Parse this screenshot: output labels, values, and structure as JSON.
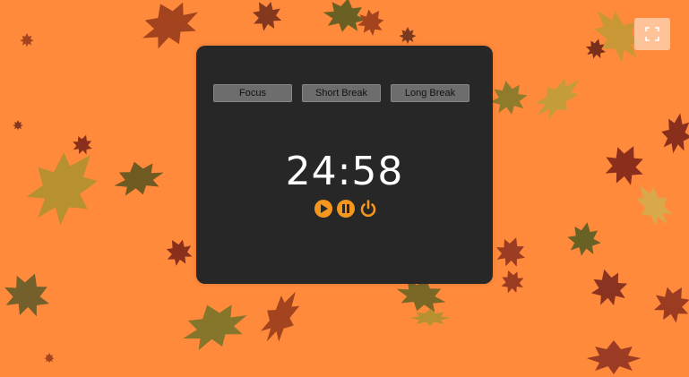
{
  "colors": {
    "background": "#ff8a3c",
    "panel": "#272727",
    "tab": "#6d6d6d",
    "accent": "#f5961e",
    "text": "#ffffff"
  },
  "modes": [
    {
      "label": "Focus"
    },
    {
      "label": "Short Break"
    },
    {
      "label": "Long Break"
    }
  ],
  "timer": {
    "display": "24:58"
  },
  "controls": [
    {
      "icon": "play-icon"
    },
    {
      "icon": "pause-icon"
    },
    {
      "icon": "power-icon"
    }
  ],
  "fullscreen": {
    "icon": "fullscreen-icon"
  }
}
